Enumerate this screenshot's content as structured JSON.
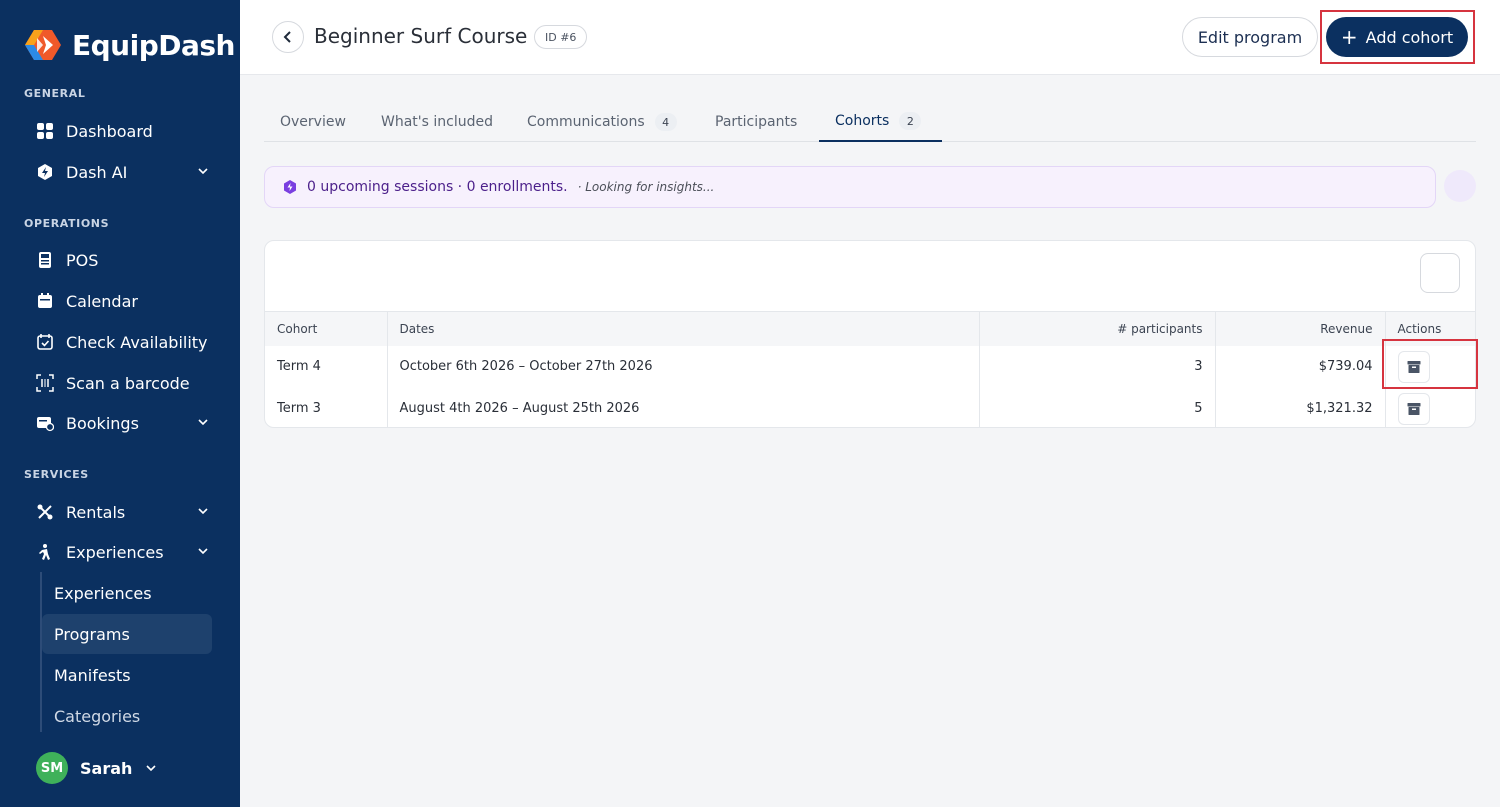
{
  "app": {
    "name": "EquipDash"
  },
  "sidebar": {
    "sections": {
      "general": "GENERAL",
      "operations": "OPERATIONS",
      "services": "SERVICES"
    },
    "items": {
      "dashboard": "Dashboard",
      "dash_ai": "Dash AI",
      "pos": "POS",
      "calendar": "Calendar",
      "check_availability": "Check Availability",
      "scan_barcode": "Scan a barcode",
      "bookings": "Bookings",
      "rentals": "Rentals",
      "experiences": "Experiences"
    },
    "sub_items": {
      "experiences": "Experiences",
      "programs": "Programs",
      "manifests": "Manifests",
      "categories": "Categories"
    },
    "user": {
      "initials": "SM",
      "name": "Sarah"
    }
  },
  "header": {
    "title": "Beginner Surf Course",
    "id_badge": "ID #6",
    "edit_label": "Edit program",
    "add_label": "Add cohort"
  },
  "tabs": [
    {
      "label": "Overview"
    },
    {
      "label": "What's included"
    },
    {
      "label": "Communications",
      "count": "4"
    },
    {
      "label": "Participants"
    },
    {
      "label": "Cohorts",
      "count": "2"
    }
  ],
  "insight": {
    "text": "0 upcoming sessions · 0 enrollments.",
    "sub": "· Looking for insights..."
  },
  "table": {
    "headers": [
      "Cohort",
      "Dates",
      "# participants",
      "Revenue",
      "Actions"
    ],
    "rows": [
      {
        "cohort": "Term 4",
        "dates": "October 6th 2026 – October 27th 2026",
        "participants": "3",
        "revenue": "$739.04"
      },
      {
        "cohort": "Term 3",
        "dates": "August 4th 2026 – August 25th 2026",
        "participants": "5",
        "revenue": "$1,321.32"
      }
    ]
  },
  "colors": {
    "brand": "#0b3060",
    "highlight": "#d6343f",
    "avatar": "#3fb15a"
  },
  "icons": [
    "dashboard-icon",
    "dash-ai-icon",
    "pos-icon",
    "calendar-icon",
    "check-availability-icon",
    "barcode-icon",
    "bookings-icon",
    "rentals-icon",
    "experiences-icon",
    "back-arrow-icon",
    "plus-icon",
    "archive-icon",
    "insight-icon"
  ]
}
